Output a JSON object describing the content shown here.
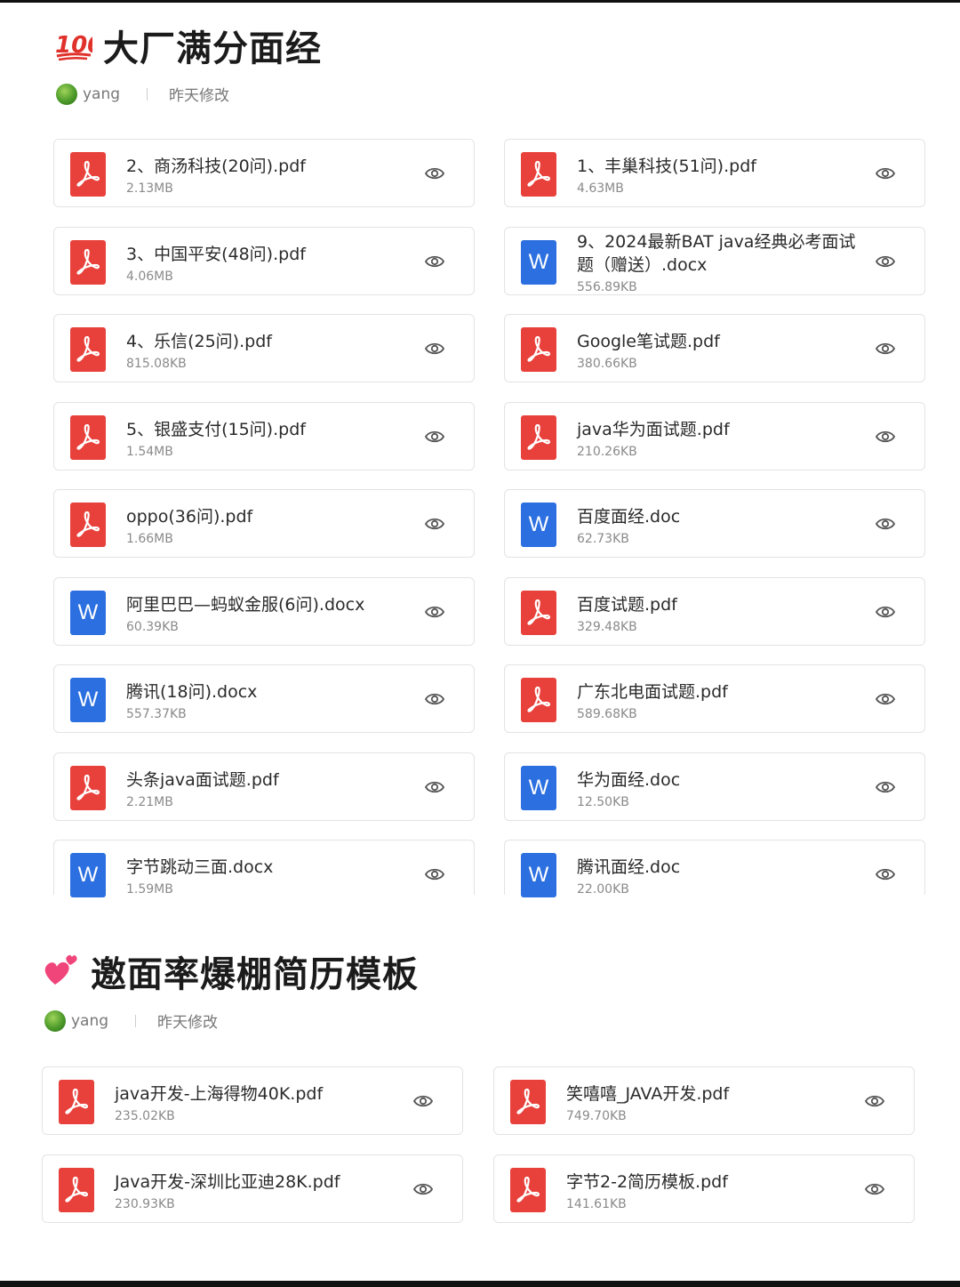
{
  "sections": [
    {
      "title": "大厂满分面经",
      "emoji_icon": "hundred-points-icon",
      "author": "yang",
      "modified": "昨天修改",
      "files": [
        {
          "name": "2、商汤科技(20问).pdf",
          "size": "2.13MB",
          "type": "pdf"
        },
        {
          "name": "1、丰巢科技(51问).pdf",
          "size": "4.63MB",
          "type": "pdf"
        },
        {
          "name": "3、中国平安(48问).pdf",
          "size": "4.06MB",
          "type": "pdf"
        },
        {
          "name": "9、2024最新BAT java经典必考面试题（赠送）.docx",
          "size": "556.89KB",
          "type": "word"
        },
        {
          "name": "4、乐信(25问).pdf",
          "size": "815.08KB",
          "type": "pdf"
        },
        {
          "name": "Google笔试题.pdf",
          "size": "380.66KB",
          "type": "pdf"
        },
        {
          "name": "5、银盛支付(15问).pdf",
          "size": "1.54MB",
          "type": "pdf"
        },
        {
          "name": "java华为面试题.pdf",
          "size": "210.26KB",
          "type": "pdf"
        },
        {
          "name": "oppo(36问).pdf",
          "size": "1.66MB",
          "type": "pdf"
        },
        {
          "name": "百度面经.doc",
          "size": "62.73KB",
          "type": "word"
        },
        {
          "name": "阿里巴巴—蚂蚁金服(6问).docx",
          "size": "60.39KB",
          "type": "word"
        },
        {
          "name": "百度试题.pdf",
          "size": "329.48KB",
          "type": "pdf"
        },
        {
          "name": "腾讯(18问).docx",
          "size": "557.37KB",
          "type": "word"
        },
        {
          "name": "广东北电面试题.pdf",
          "size": "589.68KB",
          "type": "pdf"
        },
        {
          "name": "头条java面试题.pdf",
          "size": "2.21MB",
          "type": "pdf"
        },
        {
          "name": "华为面经.doc",
          "size": "12.50KB",
          "type": "word"
        },
        {
          "name": "字节跳动三面.docx",
          "size": "1.59MB",
          "type": "word"
        },
        {
          "name": "腾讯面经.doc",
          "size": "22.00KB",
          "type": "word"
        }
      ]
    },
    {
      "title": "邀面率爆棚简历模板",
      "emoji_icon": "two-hearts-icon",
      "author": "yang",
      "modified": "昨天修改",
      "files": [
        {
          "name": "java开发-上海得物40K.pdf",
          "size": "235.02KB",
          "type": "pdf"
        },
        {
          "name": "笑嘻嘻_JAVA开发.pdf",
          "size": "749.70KB",
          "type": "pdf"
        },
        {
          "name": "Java开发-深圳比亚迪28K.pdf",
          "size": "230.93KB",
          "type": "pdf"
        },
        {
          "name": "字节2-2简历模板.pdf",
          "size": "141.61KB",
          "type": "pdf"
        }
      ]
    }
  ],
  "colors": {
    "pdf": "#e8403a",
    "word": "#2b6fe0"
  }
}
